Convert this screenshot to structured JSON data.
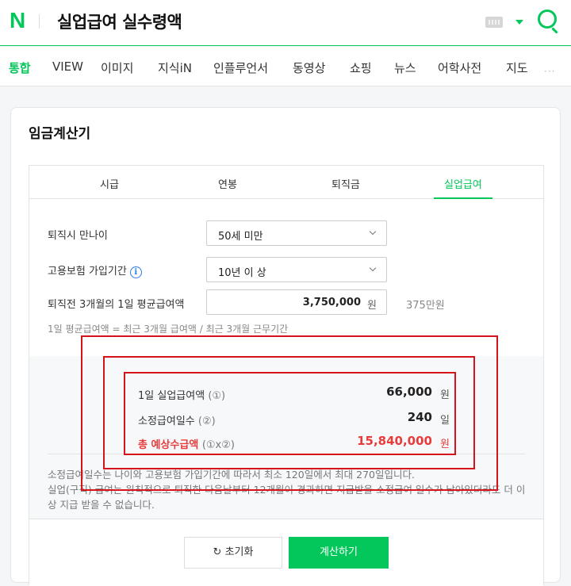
{
  "header": {
    "logo": "N",
    "query": "실업급여 실수령액"
  },
  "tabs": [
    "통합",
    "VIEW",
    "이미지",
    "지식iN",
    "인플루언서",
    "동영상",
    "쇼핑",
    "뉴스",
    "어학사전",
    "지도"
  ],
  "more": "···",
  "card": {
    "title": "임금계산기",
    "calc_tabs": [
      "시급",
      "연봉",
      "퇴직금",
      "실업급여"
    ],
    "active_tab": "실업급여",
    "form": {
      "age_label": "퇴직시 만나이",
      "age_value": "50세 미만",
      "insurance_label": "고용보험 가입기간",
      "info_glyph": "i",
      "insurance_value": "10년 이 상",
      "wage_label": "퇴직전 3개월의 1일 평균급여액",
      "wage_value": "3,750,000",
      "wage_unit": "원",
      "wage_hint": "375만원",
      "formula": "1일 평균급여액 = 최근 3개월 급여액 / 최근 3개월 근무기간"
    },
    "results": {
      "daily_label": "1일 실업급여액",
      "daily_sub": "(①)",
      "daily_value": "66,000",
      "daily_unit": "원",
      "days_label": "소정급여일수",
      "days_sub": "(②)",
      "days_value": "240",
      "days_unit": "일",
      "total_label": "총 예상수급액",
      "total_sub": "(①x②)",
      "total_value": "15,840,000",
      "total_unit": "원"
    },
    "notes": [
      "소정급여일수는 나이와 고용보험 가입기간에 따라서 최소 120일에서 최대 270일입니다.",
      "실업(구직) 급여는 원칙적으로 퇴직한 다음날부터 12개월이 경과하면 지급받을 소정급여 일수가 남아있더라도 더 이상 지급 받을 수 없습니다."
    ],
    "buttons": {
      "reset_icon": "↻",
      "reset": "초기화",
      "calc": "계산하기"
    }
  }
}
